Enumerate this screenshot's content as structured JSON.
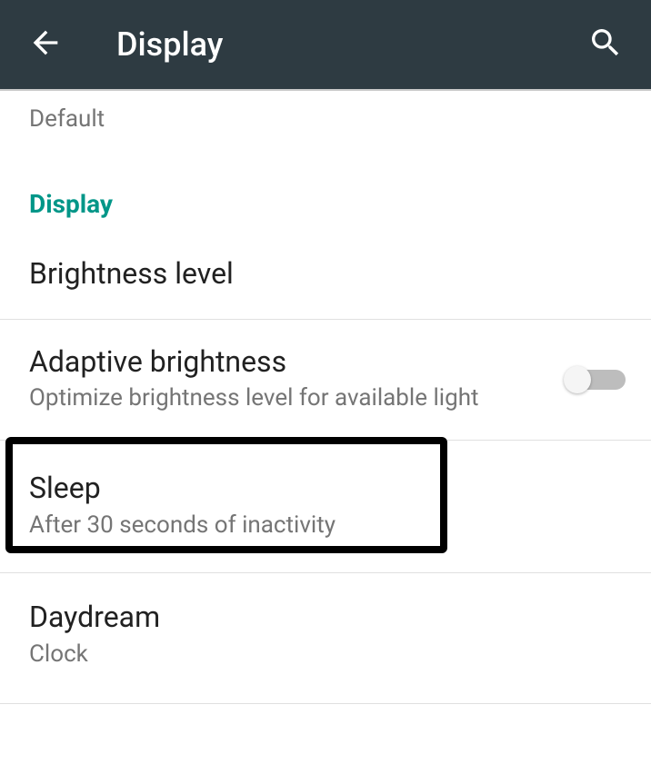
{
  "header": {
    "title": "Display"
  },
  "partial": {
    "subtitle": "Default"
  },
  "section": {
    "label": "Display"
  },
  "items": {
    "brightness": {
      "title": "Brightness level"
    },
    "adaptive": {
      "title": "Adaptive brightness",
      "subtitle": "Optimize brightness level for available light"
    },
    "sleep": {
      "title": "Sleep",
      "subtitle": "After 30 seconds of inactivity"
    },
    "daydream": {
      "title": "Daydream",
      "subtitle": "Clock"
    }
  }
}
